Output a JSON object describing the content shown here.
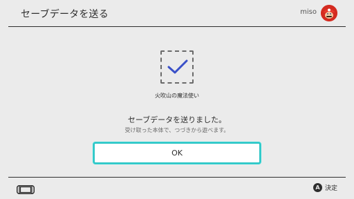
{
  "header": {
    "title": "セーブデータを送る",
    "username": "miso",
    "avatar_icon": "mario-avatar"
  },
  "save": {
    "icon": "check-icon",
    "game_name": "火吹山の魔法使い"
  },
  "message": {
    "main": "セーブデータを送りました。",
    "sub": "受け取った本体で、つづきから遊べます。"
  },
  "ok_button": {
    "label": "OK"
  },
  "footer": {
    "console_icon": "switch-console-icon",
    "action_button": "A",
    "action_label": "決定"
  },
  "colors": {
    "background": "#ebebeb",
    "accent": "#2ec5c5",
    "check": "#3a50c8",
    "avatar": "#d42b20"
  }
}
